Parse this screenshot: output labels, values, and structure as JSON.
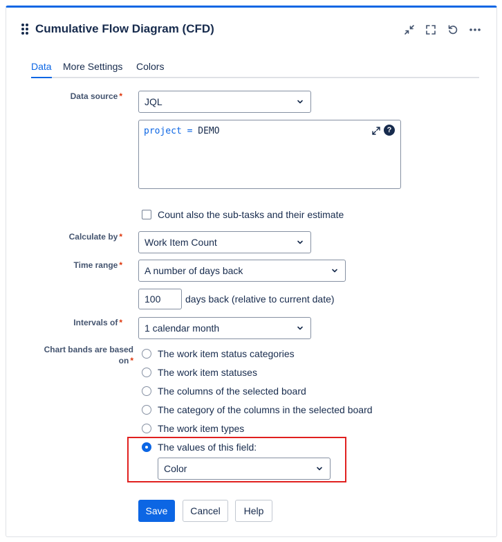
{
  "gadget": {
    "title": "Cumulative Flow Diagram (CFD)",
    "header_icons": [
      "minimize-icon",
      "fullscreen-icon",
      "refresh-icon",
      "more-icon"
    ]
  },
  "tabs": [
    {
      "label": "Data",
      "active": true
    },
    {
      "label": "More Settings",
      "active": false
    },
    {
      "label": "Colors",
      "active": false
    }
  ],
  "form": {
    "data_source": {
      "label": "Data source",
      "value": "JQL"
    },
    "jql": {
      "keyword": "project",
      "operator": "=",
      "value": "DEMO",
      "help": "?"
    },
    "subtasks": {
      "label": "Count also the sub-tasks and their estimate",
      "checked": false
    },
    "calculate_by": {
      "label": "Calculate by",
      "value": "Work Item Count"
    },
    "time_range": {
      "label": "Time range",
      "value": "A number of days back"
    },
    "days_back": {
      "value": "100",
      "suffix": "days back (relative to current date)"
    },
    "intervals": {
      "label": "Intervals of",
      "value": "1 calendar month"
    },
    "chart_bands": {
      "label": "Chart bands are based on",
      "options": [
        "The work item status categories",
        "The work item statuses",
        "The columns of the selected board",
        "The category of the columns in the selected board",
        "The work item types",
        "The values of this field:"
      ],
      "selected_index": 5,
      "field_value": "Color"
    }
  },
  "buttons": {
    "save": "Save",
    "cancel": "Cancel",
    "help": "Help"
  },
  "colors": {
    "accent": "#0c66e4",
    "required": "#de350b",
    "highlight": "#e0201f"
  }
}
